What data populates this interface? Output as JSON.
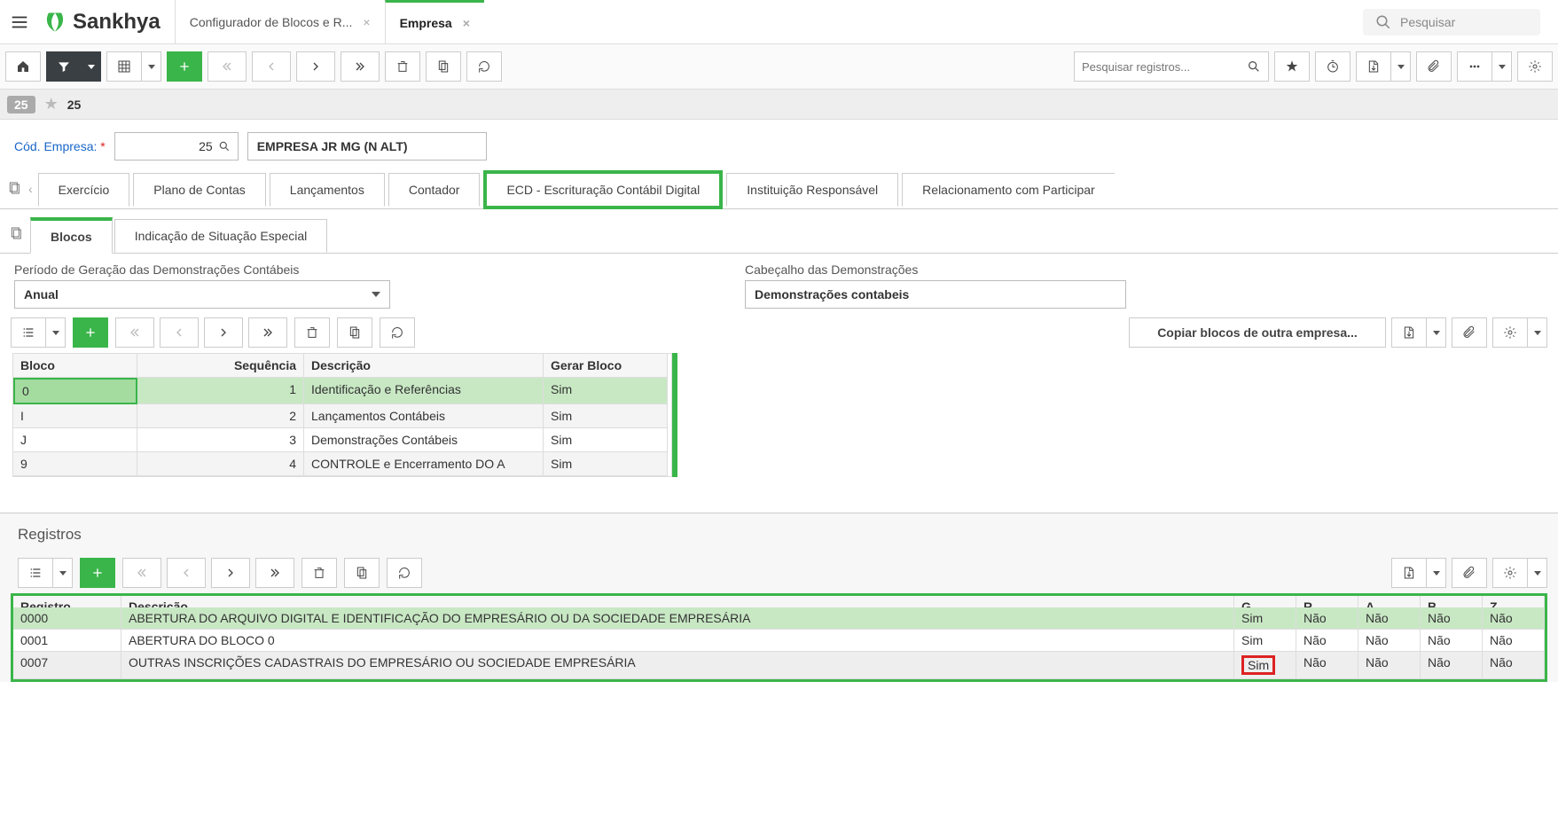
{
  "header": {
    "logo_text": "Sankhya",
    "breadcrumb_tab1": "Configurador de Blocos e R...",
    "breadcrumb_tab2": "Empresa",
    "global_search_placeholder": "Pesquisar"
  },
  "toolbar": {
    "search_placeholder": "Pesquisar registros..."
  },
  "badge": {
    "count": "25",
    "star_count": "25"
  },
  "form": {
    "cod_empresa_label": "Cód. Empresa:",
    "cod_empresa_value": "25",
    "empresa_name": "EMPRESA JR MG (N ALT)"
  },
  "main_tabs": {
    "t1": "Exercício",
    "t2": "Plano de Contas",
    "t3": "Lançamentos",
    "t4": "Contador",
    "t5": "ECD - Escrituração Contábil Digital",
    "t6": "Instituição Responsável",
    "t7": "Relacionamento com Participar"
  },
  "sub_tabs": {
    "t1": "Blocos",
    "t2": "Indicação de Situação Especial"
  },
  "fields": {
    "periodo_label": "Período de Geração das Demonstrações Contábeis",
    "periodo_value": "Anual",
    "cabecalho_label": "Cabeçalho das Demonstrações",
    "cabecalho_value": "Demonstrações contabeis",
    "copiar_button": "Copiar blocos de outra empresa..."
  },
  "blocos_table": {
    "headers": {
      "bloco": "Bloco",
      "seq": "Sequência",
      "desc": "Descrição",
      "gerar": "Gerar Bloco"
    },
    "rows": [
      {
        "bloco": "0",
        "seq": "1",
        "desc": "Identificação e Referências",
        "gerar": "Sim"
      },
      {
        "bloco": "I",
        "seq": "2",
        "desc": "Lançamentos Contábeis",
        "gerar": "Sim"
      },
      {
        "bloco": "J",
        "seq": "3",
        "desc": "Demonstrações Contábeis",
        "gerar": "Sim"
      },
      {
        "bloco": "9",
        "seq": "4",
        "desc": "CONTROLE e Encerramento DO A",
        "gerar": "Sim"
      }
    ]
  },
  "registros": {
    "title": "Registros",
    "headers": {
      "reg": "Registro",
      "desc": "Descrição",
      "g": "G",
      "r": "R",
      "a": "A",
      "b": "B",
      "z": "Z"
    },
    "rows": [
      {
        "reg": "0000",
        "desc": "ABERTURA DO ARQUIVO DIGITAL E IDENTIFICAÇÃO DO EMPRESÁRIO OU DA SOCIEDADE EMPRESÁRIA",
        "g": "Sim",
        "r": "Não",
        "a": "Não",
        "b": "Não",
        "z": "Não"
      },
      {
        "reg": "0001",
        "desc": "ABERTURA DO BLOCO 0",
        "g": "Sim",
        "r": "Não",
        "a": "Não",
        "b": "Não",
        "z": "Não"
      },
      {
        "reg": "0007",
        "desc": "OUTRAS INSCRIÇÕES CADASTRAIS DO EMPRESÁRIO OU SOCIEDADE EMPRESÁRIA",
        "g": "Sim",
        "r": "Não",
        "a": "Não",
        "b": "Não",
        "z": "Não"
      }
    ]
  }
}
